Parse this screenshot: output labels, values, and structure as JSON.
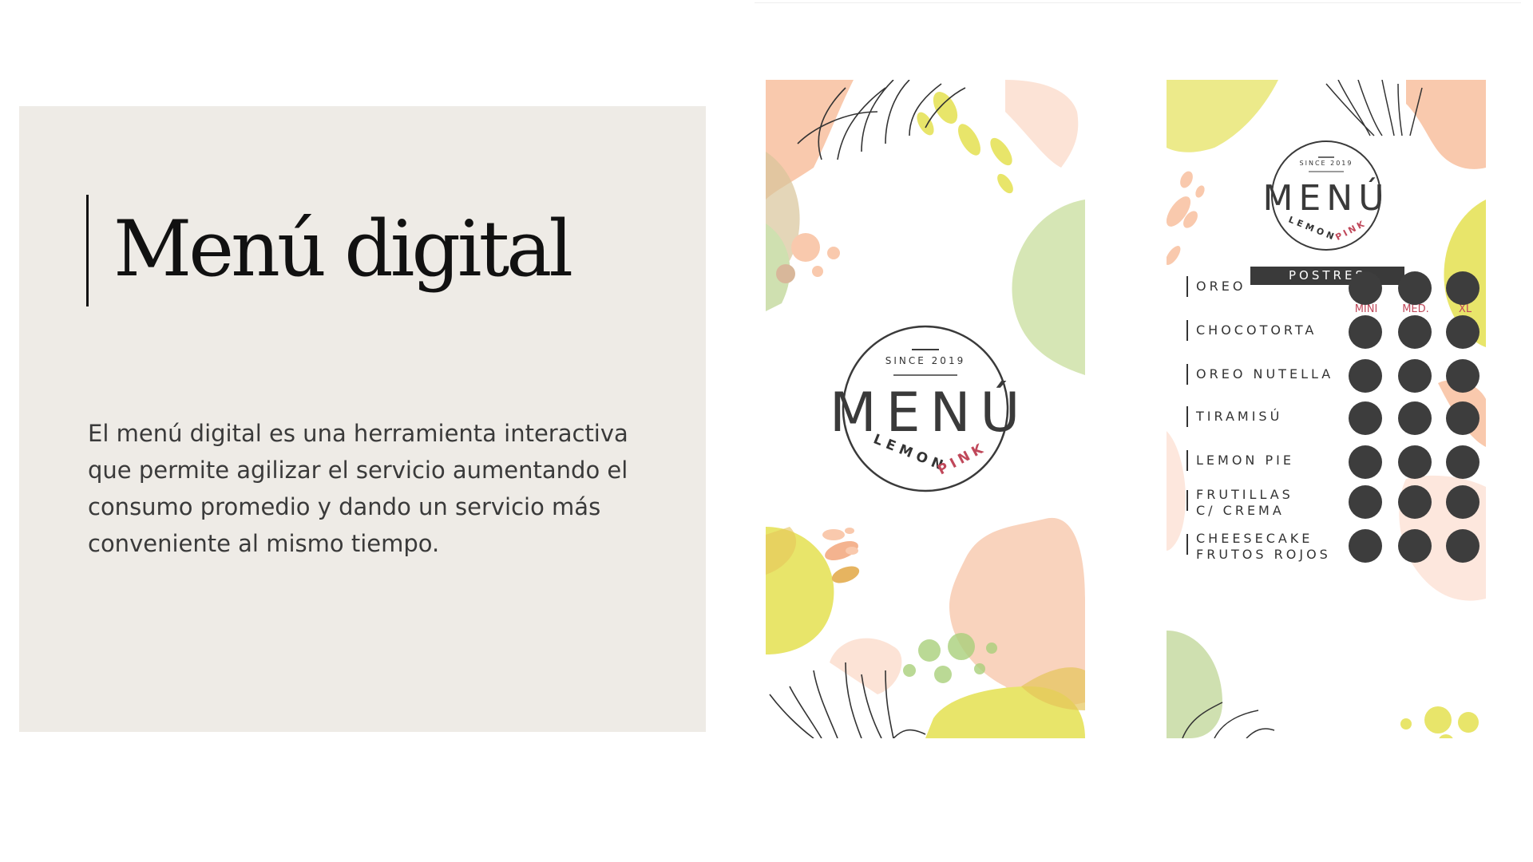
{
  "slide": {
    "title": "Menú digital",
    "description": "El menú digital es una herramienta interactiva que permite agilizar el servicio aumentando el consumo promedio y dando un servicio más conveniente al mismo tiempo."
  },
  "logo": {
    "since": "SINCE 2019",
    "word": "MENÚ",
    "brand_a": "LEMON",
    "brand_b": "PINK"
  },
  "dessert_menu": {
    "section": "POSTRES",
    "sizes": [
      "MINI",
      "MED.",
      "XL"
    ],
    "items": [
      {
        "name": "OREO"
      },
      {
        "name": "CHOCOTORTA"
      },
      {
        "name": "OREO NUTELLA"
      },
      {
        "name": "TIRAMISÚ"
      },
      {
        "name": "LEMON PIE"
      },
      {
        "name": "FRUTILLAS\nC/ CREMA"
      },
      {
        "name": "CHEESECAKE\nFRUTOS ROJOS"
      }
    ]
  },
  "colors": {
    "panel": "#eeebe6",
    "peach": "#f9c9ad",
    "lemon": "#e8e56a",
    "sage": "#cfe0b0",
    "pink_accent": "#c0485a",
    "dark": "#3d3d3d"
  }
}
